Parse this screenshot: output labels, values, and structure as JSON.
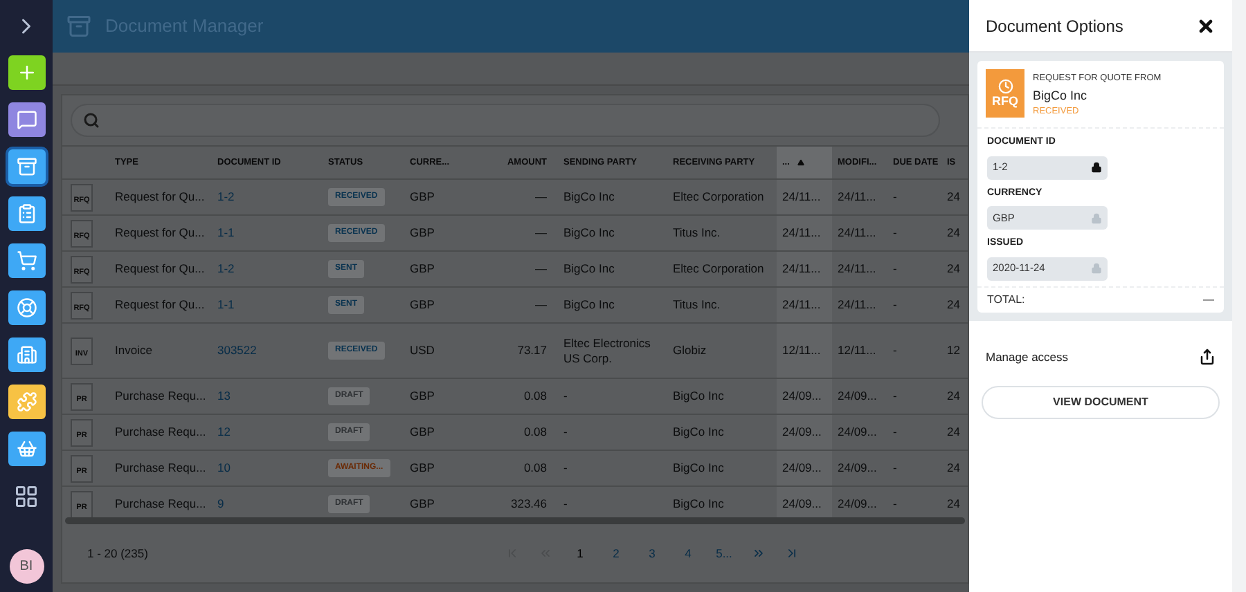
{
  "sidebar": {
    "items": [
      {
        "kind": "expand",
        "selected": false
      },
      {
        "kind": "add",
        "selected": false
      },
      {
        "kind": "chat",
        "selected": false
      },
      {
        "kind": "archive",
        "selected": true
      },
      {
        "kind": "clipboard",
        "selected": false
      },
      {
        "kind": "cart",
        "selected": false
      },
      {
        "kind": "lifebuoy",
        "selected": false
      },
      {
        "kind": "building",
        "selected": false
      },
      {
        "kind": "puzzle",
        "selected": false
      },
      {
        "kind": "basket",
        "selected": false
      },
      {
        "kind": "grid",
        "selected": false
      }
    ],
    "avatar": "BI"
  },
  "header": {
    "title": "Document Manager"
  },
  "table": {
    "columns": [
      {
        "label": "TYPE",
        "sorted": false
      },
      {
        "label": "DOCUMENT ID",
        "sorted": false
      },
      {
        "label": "STATUS",
        "sorted": false
      },
      {
        "label": "CURRE...",
        "sorted": false
      },
      {
        "label": "AMOUNT",
        "sorted": false
      },
      {
        "label": "SENDING PARTY",
        "sorted": false
      },
      {
        "label": "RECEIVING PARTY",
        "sorted": false
      },
      {
        "label": "...",
        "sorted": true
      },
      {
        "label": "MODIFI...",
        "sorted": false
      },
      {
        "label": "DUE DATE",
        "sorted": false
      },
      {
        "label": "IS",
        "sorted": false
      }
    ],
    "rows": [
      {
        "icon": "RFQ",
        "type": "Request for Qu...",
        "id": "1-2",
        "status": {
          "label": "RECEIVED",
          "color": "#08324f"
        },
        "currency": "GBP",
        "amount": "—",
        "sender": "BigCo Inc",
        "receiver": "Eltec Corporation",
        "date": "24/11...",
        "modified": "24/11...",
        "due": "-",
        "issued": "24"
      },
      {
        "icon": "RFQ",
        "type": "Request for Qu...",
        "id": "1-1",
        "status": {
          "label": "RECEIVED",
          "color": "#08324f"
        },
        "currency": "GBP",
        "amount": "—",
        "sender": "BigCo Inc",
        "receiver": "Titus Inc.",
        "date": "24/11...",
        "modified": "24/11...",
        "due": "-",
        "issued": "24"
      },
      {
        "icon": "RFQ",
        "type": "Request for Qu...",
        "id": "1-2",
        "status": {
          "label": "SENT",
          "color": "#08324f"
        },
        "currency": "GBP",
        "amount": "—",
        "sender": "BigCo Inc",
        "receiver": "Eltec Corporation",
        "date": "24/11...",
        "modified": "24/11...",
        "due": "-",
        "issued": "24"
      },
      {
        "icon": "RFQ",
        "type": "Request for Qu...",
        "id": "1-1",
        "status": {
          "label": "SENT",
          "color": "#08324f"
        },
        "currency": "GBP",
        "amount": "—",
        "sender": "BigCo Inc",
        "receiver": "Titus Inc.",
        "date": "24/11...",
        "modified": "24/11...",
        "due": "-",
        "issued": "24"
      },
      {
        "icon": "INV",
        "type": "Invoice",
        "id": "303522",
        "status": {
          "label": "RECEIVED",
          "color": "#08324f"
        },
        "currency": "USD",
        "amount": "73.17",
        "sender": "Eltec Electronics US Corp.",
        "receiver": "Globiz",
        "date": "12/11...",
        "modified": "12/11...",
        "due": "-",
        "issued": "12"
      },
      {
        "icon": "PR",
        "type": "Purchase Requ...",
        "id": "13",
        "status": {
          "label": "DRAFT",
          "color": "#2e3134"
        },
        "currency": "GBP",
        "amount": "0.08",
        "sender": "-",
        "receiver": "BigCo Inc",
        "date": "24/09...",
        "modified": "24/09...",
        "due": "-",
        "issued": "24"
      },
      {
        "icon": "PR",
        "type": "Purchase Requ...",
        "id": "12",
        "status": {
          "label": "DRAFT",
          "color": "#2e3134"
        },
        "currency": "GBP",
        "amount": "0.08",
        "sender": "-",
        "receiver": "BigCo Inc",
        "date": "24/09...",
        "modified": "24/09...",
        "due": "-",
        "issued": "24"
      },
      {
        "icon": "PR",
        "type": "Purchase Requ...",
        "id": "10",
        "status": {
          "label": "AWAITING...",
          "color": "#6a2a05"
        },
        "currency": "GBP",
        "amount": "0.08",
        "sender": "-",
        "receiver": "BigCo Inc",
        "date": "24/09...",
        "modified": "24/09...",
        "due": "-",
        "issued": "24"
      },
      {
        "icon": "PR",
        "type": "Purchase Requ...",
        "id": "9",
        "status": {
          "label": "DRAFT",
          "color": "#2e3134"
        },
        "currency": "GBP",
        "amount": "323.46",
        "sender": "-",
        "receiver": "BigCo Inc",
        "date": "24/09...",
        "modified": "24/09...",
        "due": "-",
        "issued": "24"
      }
    ]
  },
  "pagination": {
    "summary": "1 - 20 (235)",
    "first_disabled": true,
    "prev_disabled": true,
    "pages": [
      {
        "label": "1",
        "selected": true
      },
      {
        "label": "2",
        "selected": false
      },
      {
        "label": "3",
        "selected": false
      },
      {
        "label": "4",
        "selected": false
      },
      {
        "label": "5...",
        "selected": false
      }
    ],
    "next_disabled": false,
    "last_disabled": false
  },
  "panel": {
    "title": "Document Options",
    "doc": {
      "icon_label": "RFQ",
      "heading": "REQUEST FOR QUOTE FROM",
      "party": "BigCo Inc",
      "status": "RECEIVED"
    },
    "fields": [
      {
        "label": "DOCUMENT ID",
        "value": "1-2",
        "lock_active": true
      },
      {
        "label": "CURRENCY",
        "value": "GBP",
        "lock_active": false
      },
      {
        "label": "ISSUED",
        "value": "2020-11-24",
        "lock_active": false
      }
    ],
    "total_label": "TOTAL:",
    "total_value": "—",
    "manage_access": "Manage access",
    "view_button": "VIEW DOCUMENT"
  }
}
